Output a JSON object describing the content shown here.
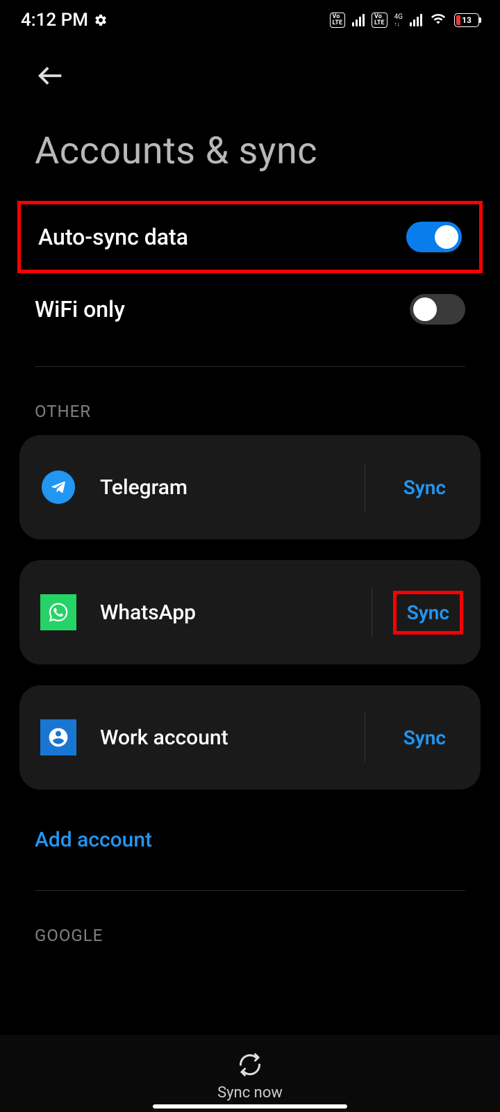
{
  "status": {
    "time": "4:12 PM",
    "battery": "13",
    "network_label": "4G"
  },
  "header": {
    "title": "Accounts & sync"
  },
  "settings": {
    "auto_sync": {
      "label": "Auto-sync data",
      "on": true
    },
    "wifi_only": {
      "label": "WiFi only",
      "on": false
    }
  },
  "sections": {
    "other": "OTHER",
    "google": "GOOGLE"
  },
  "accounts": [
    {
      "name": "Telegram",
      "action": "Sync"
    },
    {
      "name": "WhatsApp",
      "action": "Sync"
    },
    {
      "name": "Work account",
      "action": "Sync"
    }
  ],
  "add_account": "Add account",
  "bottom": {
    "sync_now": "Sync now"
  }
}
